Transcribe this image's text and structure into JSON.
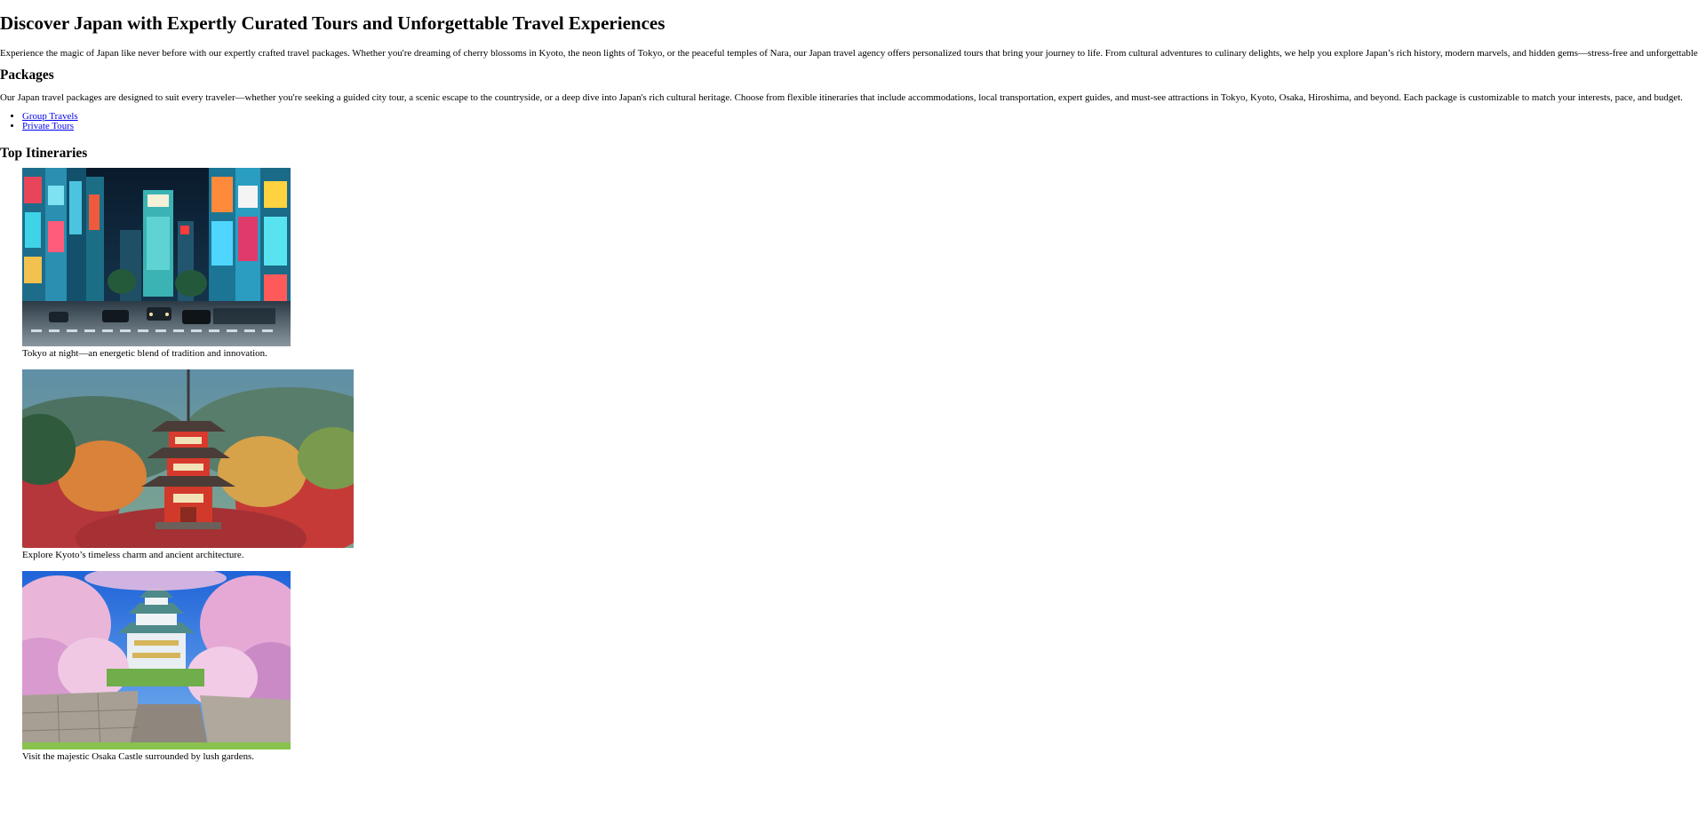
{
  "page": {
    "title": "Discover Japan with Expertly Curated Tours and Unforgettable Travel Experiences",
    "intro": "Experience the magic of Japan like never before with our expertly crafted travel packages. Whether you're dreaming of cherry blossoms in Kyoto, the neon lights of Tokyo, or the peaceful temples of Nara, our Japan travel agency offers personalized tours that bring your journey to life. From cultural adventures to culinary delights, we help you explore Japan’s rich history, modern marvels, and hidden gems—stress-free and unforgettable."
  },
  "packages": {
    "heading": "Packages",
    "description": "Our Japan travel packages are designed to suit every traveler—whether you're seeking a guided city tour, a scenic escape to the countryside, or a deep dive into Japan's rich cultural heritage. Choose from flexible itineraries that include accommodations, local transportation, expert guides, and must-see attractions in Tokyo, Kyoto, Osaka, Hiroshima, and beyond. Each package is customizable to match your interests, pace, and budget.",
    "links": [
      {
        "label": "Group Travels"
      },
      {
        "label": "Private Tours"
      }
    ]
  },
  "itineraries": {
    "heading": "Top Itineraries",
    "items": [
      {
        "caption": "Tokyo at night—an energetic blend of tradition and innovation."
      },
      {
        "caption": "Explore Kyoto’s timeless charm and ancient architecture."
      },
      {
        "caption": "Visit the majestic Osaka Castle surrounded by lush gardens."
      }
    ]
  },
  "colors": {
    "link": "#0000ee",
    "text": "#000000",
    "background": "#ffffff"
  }
}
